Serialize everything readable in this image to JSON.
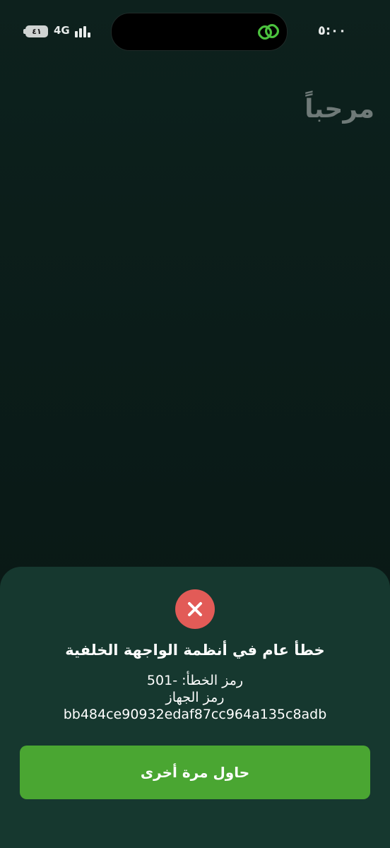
{
  "status_bar": {
    "battery_level": "٤١",
    "network": "4G",
    "time": "٥:٠٠",
    "link_icon": "link-icon",
    "colors": {
      "link": "#4bc23e"
    }
  },
  "main": {
    "greeting": "مرحباً"
  },
  "error_sheet": {
    "icon": "close-icon",
    "title": "خطأ عام في أنظمة الواجهة الخلفية",
    "error_code_line": "رمز الخطأ: -501",
    "device_label": "رمز الجهاز",
    "device_id": "bb484ce90932edaf87cc964a135c8adb",
    "retry_label": "حاول مرة أخرى",
    "colors": {
      "sheet_bg": "#16382f",
      "error_icon_bg": "#e25b57",
      "button_bg": "#4aa632"
    }
  }
}
